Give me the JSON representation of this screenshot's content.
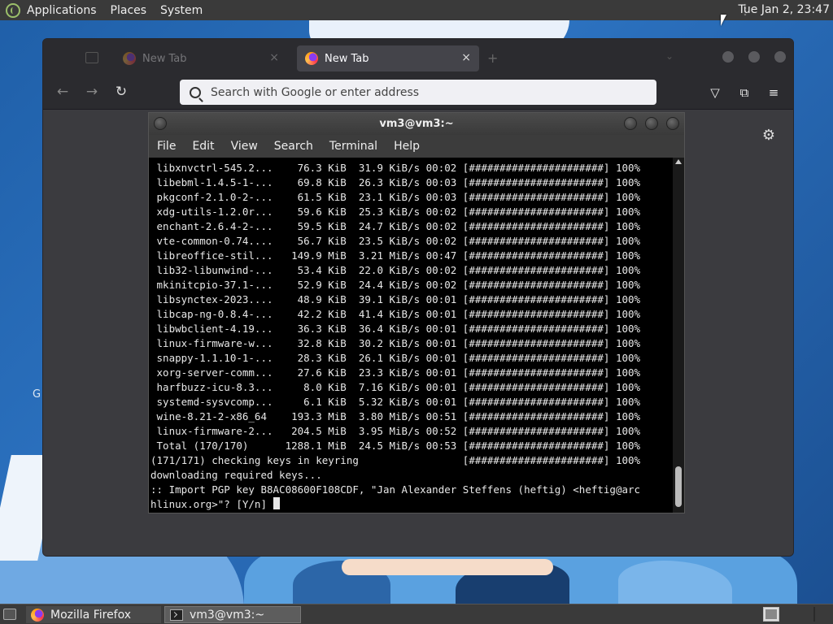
{
  "top_panel": {
    "menus": [
      "Applications",
      "Places",
      "System"
    ],
    "clock": "Tue Jan  2, 23:47"
  },
  "desktop": {
    "partial_icon_text": "G"
  },
  "firefox": {
    "tabs": [
      {
        "title": "New Tab",
        "active": false
      },
      {
        "title": "New Tab",
        "active": true
      }
    ],
    "tab_close": "×",
    "new_tab_icon": "+",
    "tab_menu_icon": "⌄",
    "nav": {
      "back": "←",
      "forward": "→",
      "reload": "↻"
    },
    "search_placeholder": "Search with Google or enter address",
    "toolbar_icons": [
      "pocket-icon",
      "extensions-icon",
      "menu-icon"
    ],
    "settings_icon": "⚙",
    "colors": {
      "urlbar_bg": "#f0f0f4",
      "chrome_bg": "#2b2b2f"
    }
  },
  "terminal": {
    "title": "vm3@vm3:~",
    "menus": [
      "File",
      "Edit",
      "View",
      "Search",
      "Terminal",
      "Help"
    ],
    "lines": [
      " libxnvctrl-545.2...    76.3 KiB  31.9 KiB/s 00:02 [######################] 100%",
      " libebml-1.4.5-1-...    69.8 KiB  26.3 KiB/s 00:03 [######################] 100%",
      " pkgconf-2.1.0-2-...    61.5 KiB  23.1 KiB/s 00:03 [######################] 100%",
      " xdg-utils-1.2.0r...    59.6 KiB  25.3 KiB/s 00:02 [######################] 100%",
      " enchant-2.6.4-2-...    59.5 KiB  24.7 KiB/s 00:02 [######################] 100%",
      " vte-common-0.74....    56.7 KiB  23.5 KiB/s 00:02 [######################] 100%",
      " libreoffice-stil...   149.9 MiB  3.21 MiB/s 00:47 [######################] 100%",
      " lib32-libunwind-...    53.4 KiB  22.0 KiB/s 00:02 [######################] 100%",
      " mkinitcpio-37.1-...    52.9 KiB  24.4 KiB/s 00:02 [######################] 100%",
      " libsynctex-2023....    48.9 KiB  39.1 KiB/s 00:01 [######################] 100%",
      " libcap-ng-0.8.4-...    42.2 KiB  41.4 KiB/s 00:01 [######################] 100%",
      " libwbclient-4.19...    36.3 KiB  36.4 KiB/s 00:01 [######################] 100%",
      " linux-firmware-w...    32.8 KiB  30.2 KiB/s 00:01 [######################] 100%",
      " snappy-1.1.10-1-...    28.3 KiB  26.1 KiB/s 00:01 [######################] 100%",
      " xorg-server-comm...    27.6 KiB  23.3 KiB/s 00:01 [######################] 100%",
      " harfbuzz-icu-8.3...     8.0 KiB  7.16 KiB/s 00:01 [######################] 100%",
      " systemd-sysvcomp...     6.1 KiB  5.32 KiB/s 00:01 [######################] 100%",
      " wine-8.21-2-x86_64    193.3 MiB  3.80 MiB/s 00:51 [######################] 100%",
      " linux-firmware-2...   204.5 MiB  3.95 MiB/s 00:52 [######################] 100%",
      " Total (170/170)      1288.1 MiB  24.5 MiB/s 00:53 [######################] 100%",
      "(171/171) checking keys in keyring                 [######################] 100%",
      "downloading required keys...",
      ":: Import PGP key B8AC08600F108CDF, \"Jan Alexander Steffens (heftig) <heftig@arc",
      "hlinux.org>\"? [Y/n] "
    ]
  },
  "taskbar": {
    "tasks": [
      "Mozilla Firefox",
      "vm3@vm3:~"
    ]
  }
}
